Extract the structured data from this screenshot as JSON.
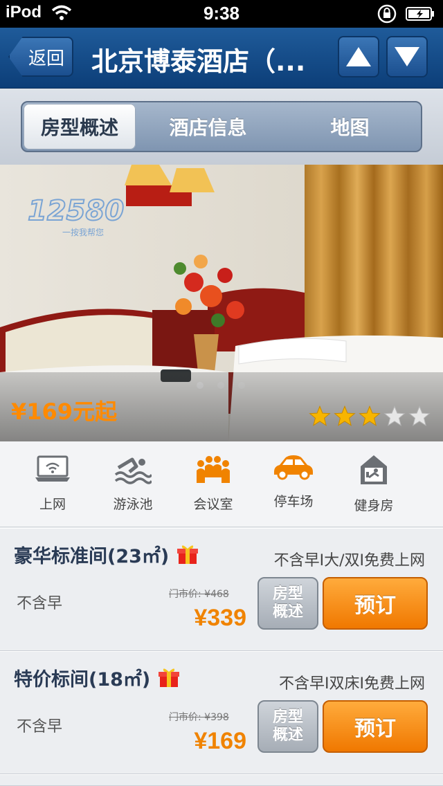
{
  "status_bar": {
    "carrier": "iPod",
    "time": "9:38"
  },
  "nav": {
    "back_label": "返回",
    "title": "北京博泰酒店（..."
  },
  "tabs": [
    {
      "label": "房型概述",
      "active": true
    },
    {
      "label": "酒店信息",
      "active": false
    },
    {
      "label": "地图",
      "active": false
    }
  ],
  "photo": {
    "watermark": "12580",
    "watermark_sub": "一按我帮您",
    "price_from": "¥169元起",
    "rating": 3,
    "rating_max": 5,
    "page_index": 1,
    "page_count": 3
  },
  "amenities": [
    {
      "label": "上网",
      "icon": "laptop-icon"
    },
    {
      "label": "游泳池",
      "icon": "swimmer-icon"
    },
    {
      "label": "会议室",
      "icon": "meeting-icon"
    },
    {
      "label": "停车场",
      "icon": "car-icon"
    },
    {
      "label": "健身房",
      "icon": "gym-icon"
    }
  ],
  "rooms": [
    {
      "name": "豪华标准间(23㎡)",
      "desc": "不含早I大/双I免费上网",
      "breakfast": "不含早",
      "market_price": "门市价: ¥468",
      "price": "¥339",
      "detail_label": "房型概述",
      "book_label": "预订"
    },
    {
      "name": "特价标间(18㎡)",
      "desc": "不含早I双床I免费上网",
      "breakfast": "不含早",
      "market_price": "门市价: ¥398",
      "price": "¥169",
      "detail_label": "房型概述",
      "book_label": "预订"
    }
  ],
  "colors": {
    "accent_orange": "#f08300",
    "nav_blue": "#1f5b9a",
    "star": "#f7b500"
  }
}
